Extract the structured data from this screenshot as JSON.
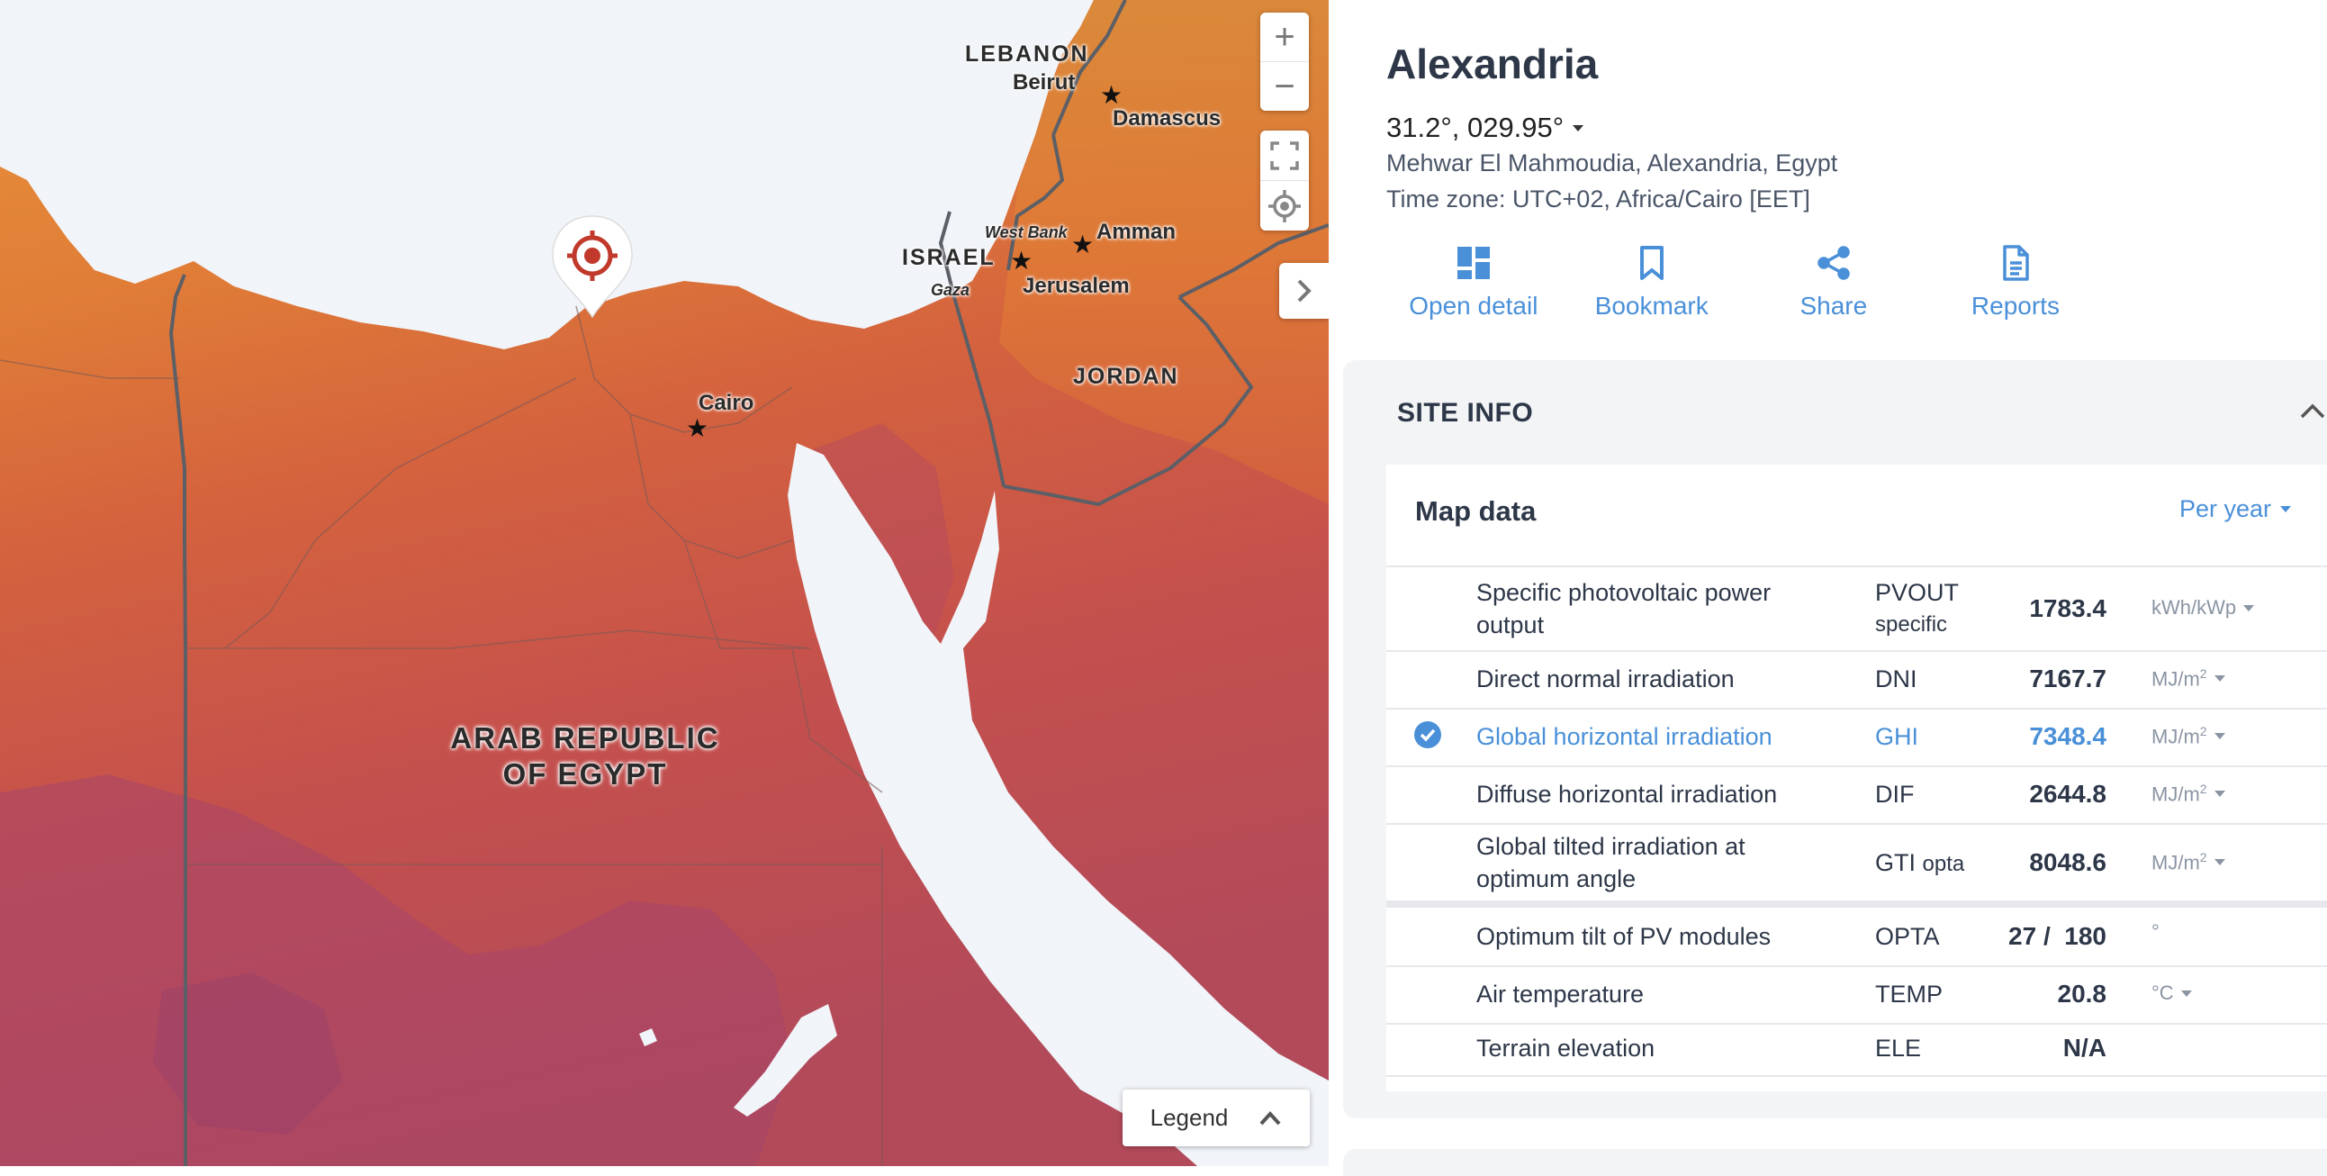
{
  "map": {
    "labels": {
      "lebanon": "LEBANON",
      "beirut": "Beirut",
      "damascus": "Damascus",
      "israel": "ISRAEL",
      "west_bank": "West Bank",
      "amman": "Amman",
      "gaza": "Gaza",
      "jerusalem": "Jerusalem",
      "jordan": "JORDAN",
      "cairo": "Cairo",
      "egypt_line1": "ARAB REPUBLIC",
      "egypt_line2": "OF EGYPT"
    },
    "controls": {
      "zoom_in": "+",
      "zoom_out": "−"
    },
    "legend_label": "Legend",
    "colors": {
      "sea": "#f1f4f8",
      "land_high": "#e38836",
      "land_mid": "#d7693b",
      "land_low": "#c24d52",
      "land_lowest": "#a84561",
      "border": "#5c5f66",
      "marker_red": "#c0392b"
    }
  },
  "panel": {
    "title": "Alexandria",
    "coords": "31.2°, 029.95°",
    "address": "Mehwar El Mahmoudia, Alexandria, Egypt",
    "timezone": "Time zone: UTC+02, Africa/Cairo [EET]",
    "actions": [
      {
        "label": "Open detail",
        "icon": "dashboard-icon"
      },
      {
        "label": "Bookmark",
        "icon": "bookmark-icon"
      },
      {
        "label": "Share",
        "icon": "share-icon"
      },
      {
        "label": "Reports",
        "icon": "document-icon"
      }
    ],
    "accent": "#4a90d9"
  },
  "site_info": {
    "heading": "SITE INFO",
    "map_data": {
      "title": "Map data",
      "period": "Per year",
      "rows": [
        {
          "name_line1": "Specific photovoltaic power",
          "name_line2": "output",
          "abbr": "PVOUT",
          "abbr_sub": "specific",
          "value": "1783.4",
          "unit": "kWh/kWp"
        },
        {
          "name": "Direct normal irradiation",
          "abbr": "DNI",
          "value": "7167.7",
          "unit": "MJ/m",
          "unit_sup": "2"
        },
        {
          "name": "Global horizontal irradiation",
          "abbr": "GHI",
          "value": "7348.4",
          "unit": "MJ/m",
          "unit_sup": "2",
          "selected": true
        },
        {
          "name": "Diffuse horizontal irradiation",
          "abbr": "DIF",
          "value": "2644.8",
          "unit": "MJ/m",
          "unit_sup": "2"
        },
        {
          "name_line1": "Global tilted irradiation at",
          "name_line2": "optimum angle",
          "abbr": "GTI",
          "abbr_sub": "opta",
          "value": "8048.6",
          "unit": "MJ/m",
          "unit_sup": "2"
        },
        {
          "name": "Optimum tilt of PV modules",
          "abbr": "OPTA",
          "value": "27 /  180",
          "unit": "°"
        },
        {
          "name": "Air temperature",
          "abbr": "TEMP",
          "value": "20.8",
          "unit": "°C"
        },
        {
          "name": "Terrain elevation",
          "abbr": "ELE",
          "value": "N/A",
          "unit": ""
        }
      ]
    }
  }
}
